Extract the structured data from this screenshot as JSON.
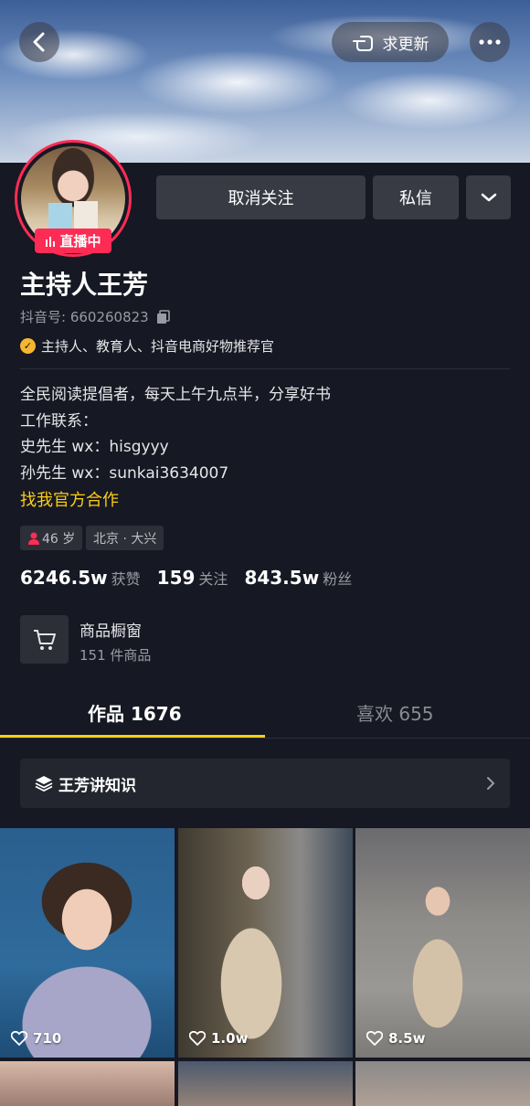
{
  "header": {
    "update_label": "求更新"
  },
  "profile": {
    "live_label": "直播中",
    "name": "主持人王芳",
    "douyin_id": "抖音号: 660260823",
    "verification": "主持人、教育人、抖音电商好物推荐官"
  },
  "actions": {
    "unfollow": "取消关注",
    "message": "私信"
  },
  "bio": {
    "lines": [
      "全民阅读提倡者，每天上午九点半，分享好书",
      "工作联系：",
      "史先生 wx：hisgyyy",
      "孙先生 wx：sunkai3634007"
    ],
    "cooperation": "找我官方合作"
  },
  "tags": {
    "age": "46 岁",
    "location": "北京 · 大兴"
  },
  "stats": [
    {
      "value": "6246.5w",
      "label": "获赞"
    },
    {
      "value": "159",
      "label": "关注"
    },
    {
      "value": "843.5w",
      "label": "粉丝"
    }
  ],
  "shop": {
    "title": "商品橱窗",
    "subtitle": "151 件商品"
  },
  "tabs": {
    "works": "作品 1676",
    "likes": "喜欢 655"
  },
  "collection": {
    "label": "王芳讲知识"
  },
  "videos": [
    {
      "likes": "710"
    },
    {
      "likes": "1.0w"
    },
    {
      "likes": "8.5w"
    }
  ],
  "colors": {
    "accent": "#fe2c55",
    "highlight": "#face15",
    "background": "#161823"
  }
}
